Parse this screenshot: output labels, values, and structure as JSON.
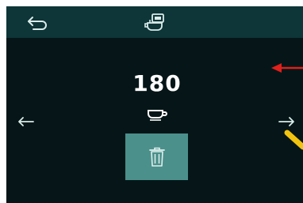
{
  "counter": {
    "value": "180"
  },
  "icons": {
    "back": "back-arrow-icon",
    "machine": "coffee-machine-icon",
    "cup": "cup-icon",
    "prev": "arrow-left-icon",
    "next": "arrow-right-icon",
    "delete": "trash-icon"
  },
  "colors": {
    "screen_bg": "#061618",
    "topbar_bg": "#0e3538",
    "delete_button_bg": "#4b908b",
    "icon_light": "#d9ecea",
    "annotation_red": "#e0201b",
    "annotation_yellow": "#f2c40f"
  }
}
